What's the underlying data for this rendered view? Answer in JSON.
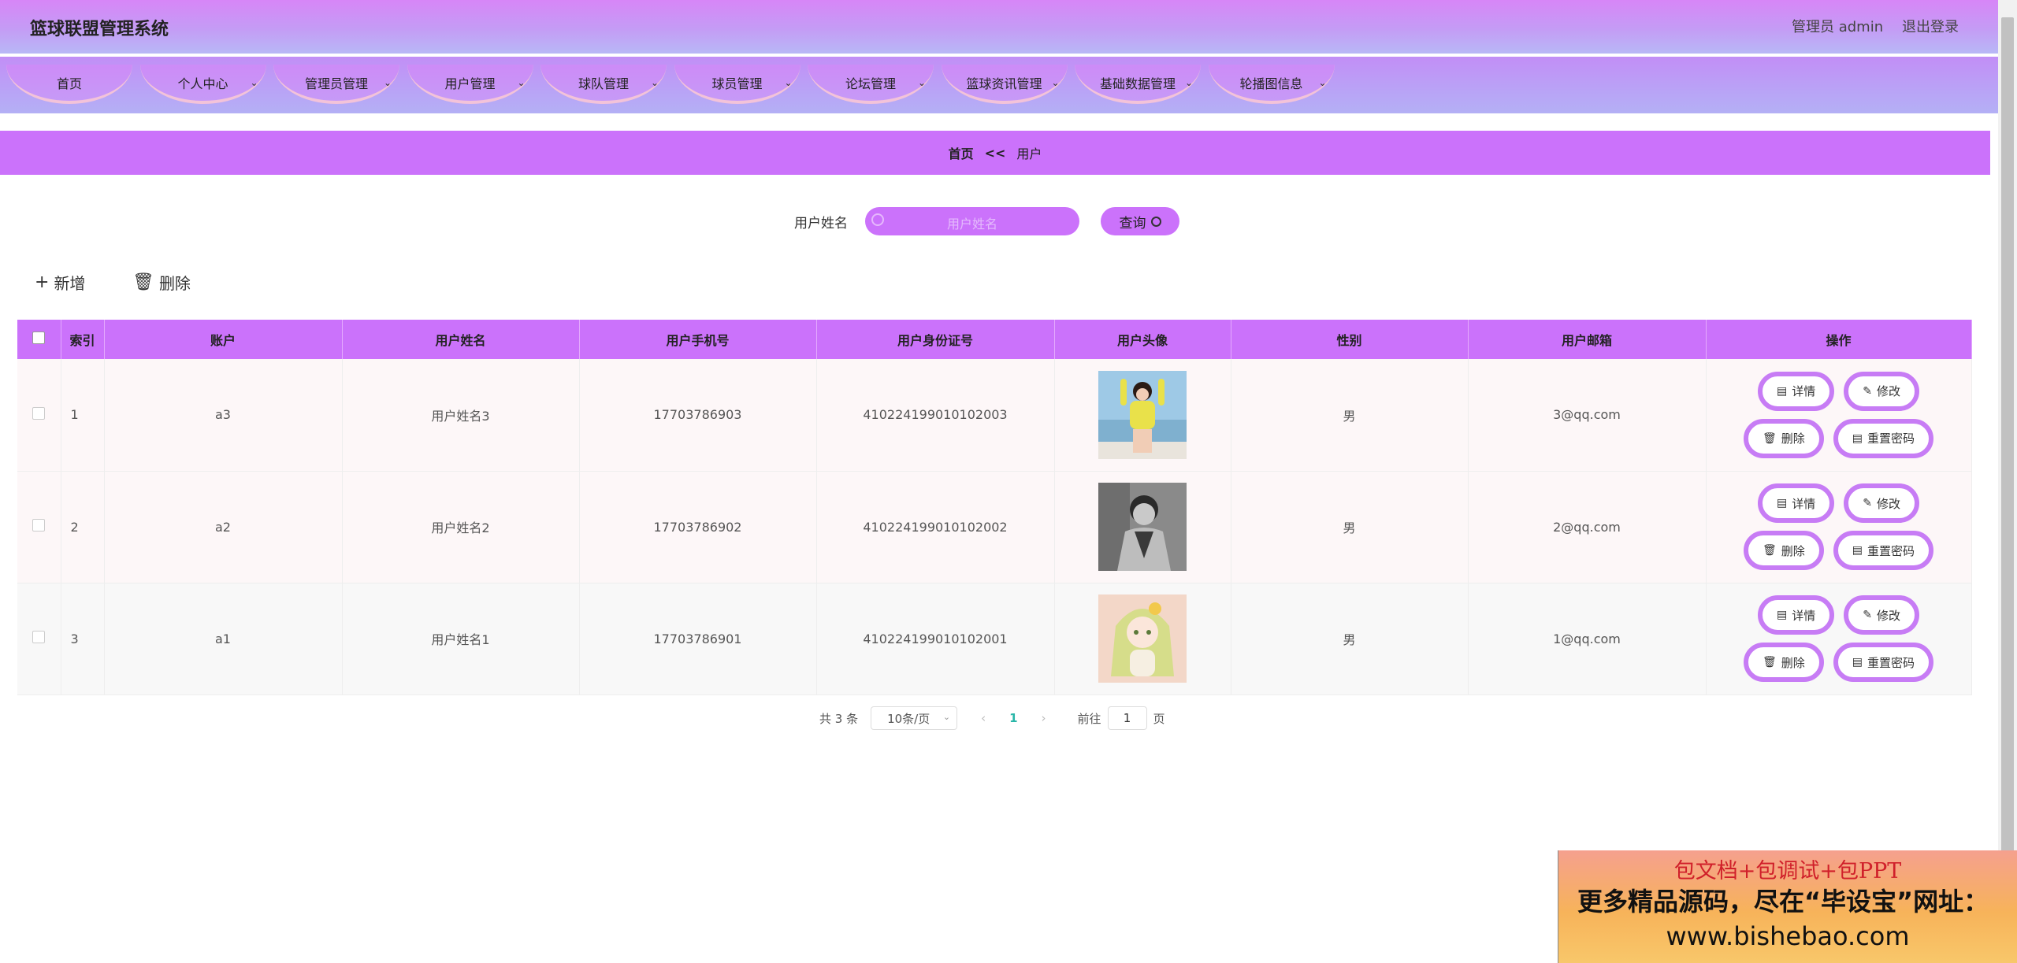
{
  "header": {
    "title": "篮球联盟管理系统",
    "user": "管理员 admin",
    "logout": "退出登录"
  },
  "nav": [
    {
      "label": "首页",
      "dropdown": false
    },
    {
      "label": "个人中心",
      "dropdown": true
    },
    {
      "label": "管理员管理",
      "dropdown": true
    },
    {
      "label": "用户管理",
      "dropdown": true
    },
    {
      "label": "球队管理",
      "dropdown": true
    },
    {
      "label": "球员管理",
      "dropdown": true
    },
    {
      "label": "论坛管理",
      "dropdown": true
    },
    {
      "label": "篮球资讯管理",
      "dropdown": true
    },
    {
      "label": "基础数据管理",
      "dropdown": true
    },
    {
      "label": "轮播图信息",
      "dropdown": true
    }
  ],
  "breadcrumb": {
    "home": "首页",
    "sep": "<<",
    "current": "用户"
  },
  "search": {
    "label": "用户姓名",
    "placeholder": "用户姓名",
    "button": "查询"
  },
  "actions": {
    "add": "新增",
    "delete": "删除"
  },
  "table": {
    "headers": [
      "索引",
      "账户",
      "用户姓名",
      "用户手机号",
      "用户身份证号",
      "用户头像",
      "性别",
      "用户邮箱",
      "操作"
    ],
    "rows": [
      {
        "index": "1",
        "account": "a3",
        "name": "用户姓名3",
        "phone": "17703786903",
        "idcard": "410224199010102003",
        "gender": "男",
        "email": "3@qq.com",
        "avatar": "girl-yellow-photo"
      },
      {
        "index": "2",
        "account": "a2",
        "name": "用户姓名2",
        "phone": "17703786902",
        "idcard": "410224199010102002",
        "gender": "男",
        "email": "2@qq.com",
        "avatar": "man-bw-photo"
      },
      {
        "index": "3",
        "account": "a1",
        "name": "用户姓名1",
        "phone": "17703786901",
        "idcard": "410224199010102001",
        "gender": "男",
        "email": "1@qq.com",
        "avatar": "anime-girl-photo"
      }
    ],
    "ops": {
      "detail": "详情",
      "edit": "修改",
      "delete": "删除",
      "reset": "重置密码"
    }
  },
  "pager": {
    "total": "共 3 条",
    "size": "10条/页",
    "page": "1",
    "goto": "前往",
    "goto_value": "1",
    "page_unit": "页"
  },
  "ad": {
    "line1": "包文档+包调试+包PPT",
    "line2": "更多精品源码，尽在“毕设宝”网址：",
    "line3": "www.bishebao.com"
  },
  "colors": {
    "accent": "#cb72fb",
    "op_border": "#c77cf5",
    "page_active": "#29b6a8"
  }
}
